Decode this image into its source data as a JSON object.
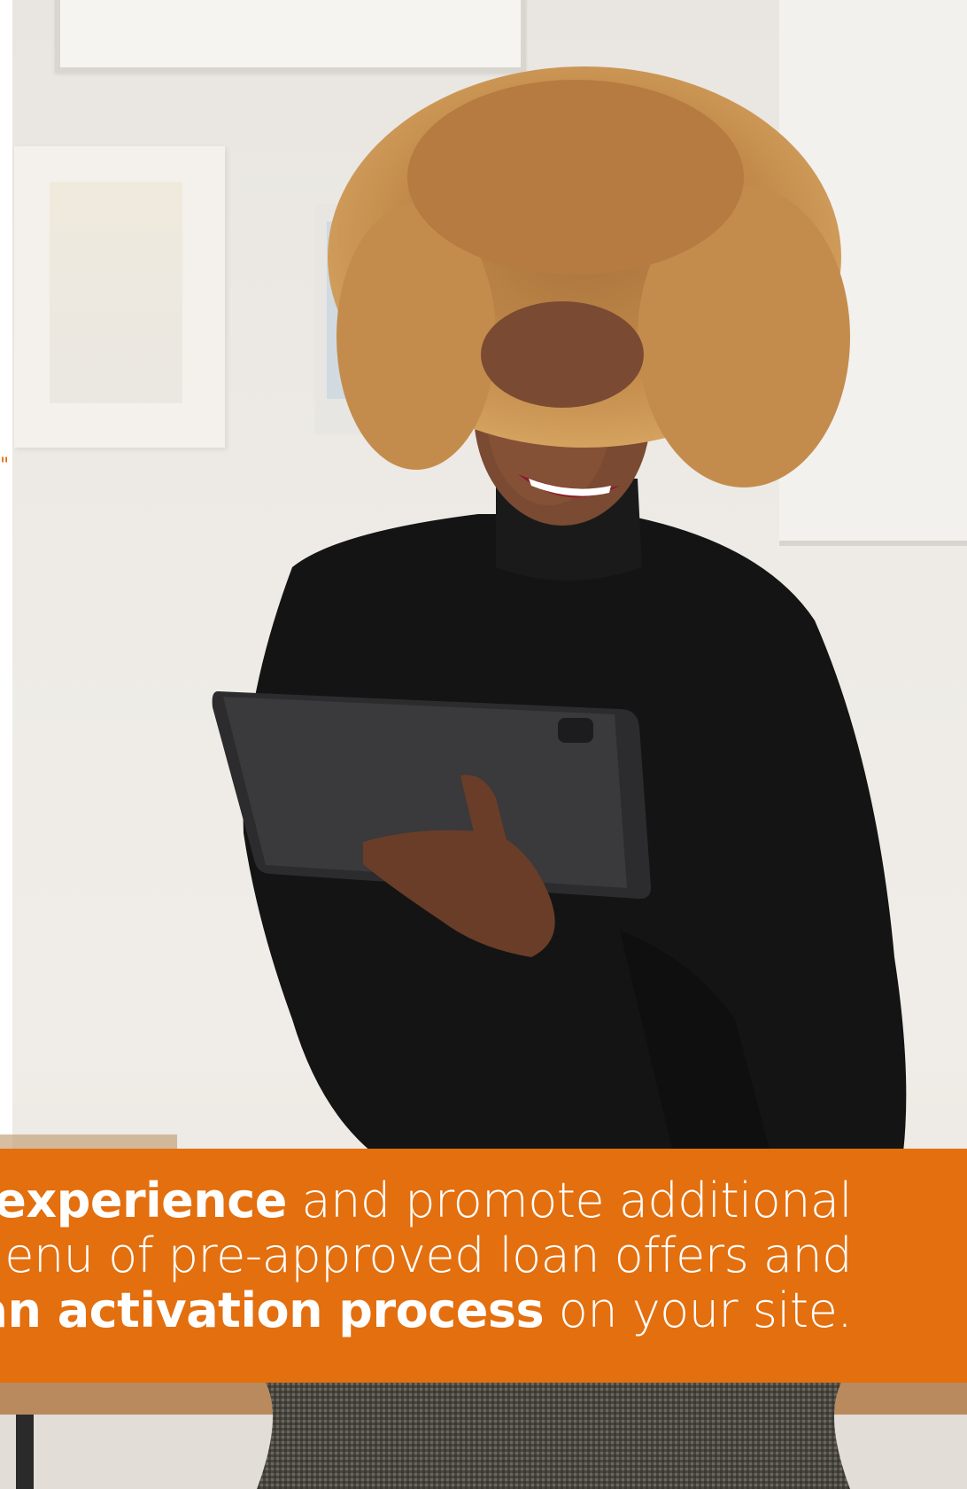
{
  "page": {
    "quote_mark": "\""
  },
  "photo": {
    "icon": "woman-with-tablet-photo"
  },
  "banner": {
    "color": "#e36f0f",
    "line1_bold": "ers’ experience",
    "line1_regular": " and promote additional",
    "line2_regular": "g a menu of pre-approved loan offers and",
    "line3_bold": "d loan activation process",
    "line3_regular": " on your site."
  }
}
